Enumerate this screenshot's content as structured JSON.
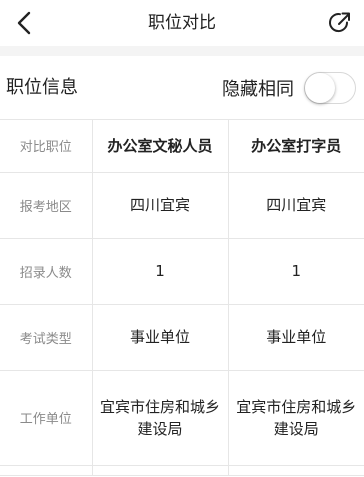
{
  "nav": {
    "title": "职位对比",
    "back_icon": "chevron-left-icon",
    "share_icon": "share-icon"
  },
  "section": {
    "title": "职位信息",
    "hide_same_label": "隐藏相同",
    "hide_same_enabled": false
  },
  "table": {
    "header": {
      "label": "对比职位",
      "position_a": "办公室文秘人员",
      "position_b": "办公室打字员"
    },
    "rows": [
      {
        "label": "报考地区",
        "a": "四川宜宾",
        "b": "四川宜宾"
      },
      {
        "label": "招录人数",
        "a": "1",
        "b": "1"
      },
      {
        "label": "考试类型",
        "a": "事业单位",
        "b": "事业单位"
      },
      {
        "label": "工作单位",
        "a": "宜宾市住房和城乡建设局",
        "b": "宜宾市住房和城乡建设局"
      }
    ]
  },
  "colors": {
    "divider": "#e6e6e6",
    "label_gray": "#8a8a8a",
    "gap_gray": "#f4f4f4"
  }
}
